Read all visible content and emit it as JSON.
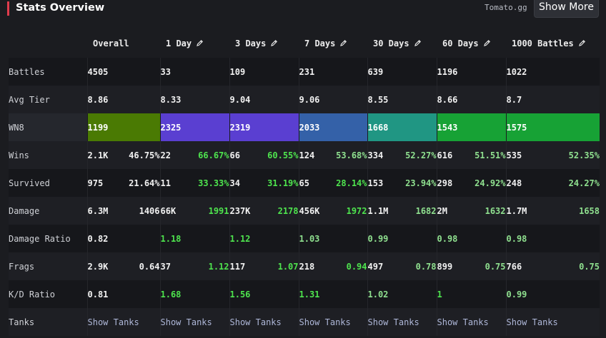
{
  "header": {
    "title": "Stats Overview",
    "source": "Tomato.gg",
    "show_more": "Show More"
  },
  "columns": [
    "Overall",
    "1 Day",
    "3 Days",
    "7 Days",
    "30 Days",
    "60 Days",
    "1000 Battles"
  ],
  "rows": {
    "battles": {
      "label": "Battles",
      "values": [
        "4505",
        "33",
        "109",
        "231",
        "639",
        "1196",
        "1022"
      ]
    },
    "avg_tier": {
      "label": "Avg Tier",
      "values": [
        "8.86",
        "8.33",
        "9.04",
        "9.06",
        "8.55",
        "8.66",
        "8.7"
      ]
    },
    "wn8": {
      "label": "WN8",
      "values": [
        "1199",
        "2325",
        "2319",
        "2033",
        "1668",
        "1543",
        "1575"
      ],
      "colors": [
        "#4a7a03",
        "#5a3fd1",
        "#5a3fd1",
        "#3461a8",
        "#209683",
        "#17a235",
        "#17a235"
      ]
    },
    "wins": {
      "label": "Wins",
      "pairs": [
        [
          "2.1K",
          "46.75%"
        ],
        [
          "22",
          "66.67%"
        ],
        [
          "66",
          "60.55%"
        ],
        [
          "124",
          "53.68%"
        ],
        [
          "334",
          "52.27%"
        ],
        [
          "616",
          "51.51%"
        ],
        [
          "535",
          "52.35%"
        ]
      ]
    },
    "survived": {
      "label": "Survived",
      "pairs": [
        [
          "975",
          "21.64%"
        ],
        [
          "11",
          "33.33%"
        ],
        [
          "34",
          "31.19%"
        ],
        [
          "65",
          "28.14%"
        ],
        [
          "153",
          "23.94%"
        ],
        [
          "298",
          "24.92%"
        ],
        [
          "248",
          "24.27%"
        ]
      ]
    },
    "damage": {
      "label": "Damage",
      "pairs": [
        [
          "6.3M",
          "1406"
        ],
        [
          "66K",
          "1991"
        ],
        [
          "237K",
          "2178"
        ],
        [
          "456K",
          "1972"
        ],
        [
          "1.1M",
          "1682"
        ],
        [
          "2M",
          "1632"
        ],
        [
          "1.7M",
          "1658"
        ]
      ]
    },
    "damage_ratio": {
      "label": "Damage Ratio",
      "values": [
        "0.82",
        "1.18",
        "1.12",
        "1.03",
        "0.99",
        "0.98",
        "0.98"
      ]
    },
    "frags": {
      "label": "Frags",
      "pairs": [
        [
          "2.9K",
          "0.64"
        ],
        [
          "37",
          "1.12"
        ],
        [
          "117",
          "1.07"
        ],
        [
          "218",
          "0.94"
        ],
        [
          "497",
          "0.78"
        ],
        [
          "899",
          "0.75"
        ],
        [
          "766",
          "0.75"
        ]
      ]
    },
    "kd_ratio": {
      "label": "K/D Ratio",
      "values": [
        "0.81",
        "1.68",
        "1.56",
        "1.31",
        "1.02",
        "1",
        "0.99"
      ]
    },
    "tanks": {
      "label": "Tanks",
      "link": "Show Tanks"
    }
  },
  "icons": {
    "edit": "pencil-icon"
  },
  "colors": {
    "accent": "#e03c4c",
    "good": "#4ee44e",
    "above_avg": "#8fe08f",
    "link": "#aeb7d8"
  }
}
